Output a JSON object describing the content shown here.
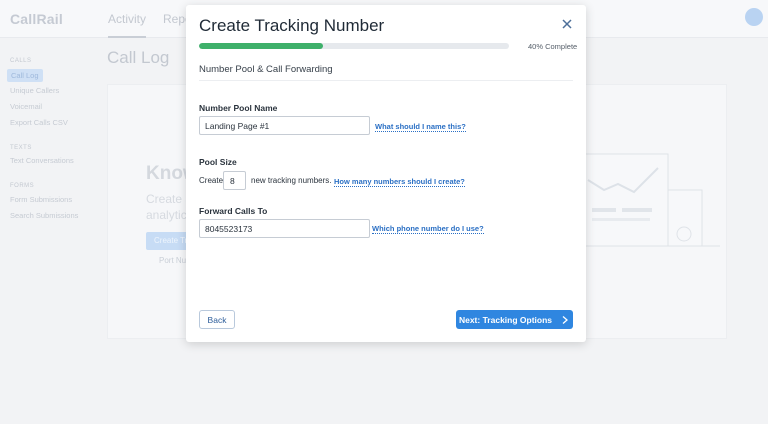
{
  "app": {
    "logo": "CallRail",
    "nav": {
      "activity": "Activity",
      "reports": "Repo"
    },
    "sidebar": {
      "calls_header": "CALLS",
      "calls_items": [
        "Call Log",
        "Unique Callers",
        "Voicemail",
        "Export Calls CSV"
      ],
      "texts_header": "TEXTS",
      "texts_items": [
        "Text Conversations"
      ],
      "forms_header": "FORMS",
      "forms_items": [
        "Form Submissions",
        "Search Submissions"
      ]
    },
    "page_title": "Call Log",
    "hero": {
      "heading": "Know",
      "line1": "Create a",
      "line2": "analytics",
      "button": "Create Tr",
      "link": "Port Nu"
    }
  },
  "modal": {
    "title": "Create Tracking Number",
    "progress": {
      "percent": 40,
      "label": "40% Complete"
    },
    "section": "Number Pool & Call Forwarding",
    "pool_name": {
      "label": "Number Pool Name",
      "value": "Landing Page #1",
      "help": "What should I name this?"
    },
    "pool_size": {
      "label": "Pool Size",
      "prefix": "Create",
      "value": "8",
      "suffix": "new tracking numbers.",
      "help": "How many numbers should I create?"
    },
    "forward": {
      "label": "Forward Calls To",
      "value": "8045523173",
      "help": "Which phone number do I use?"
    },
    "back_label": "Back",
    "next_label": "Next: Tracking Options",
    "colors": {
      "primary": "#2f86e0",
      "progress": "#3eb06a",
      "link": "#2a6fc4"
    }
  }
}
